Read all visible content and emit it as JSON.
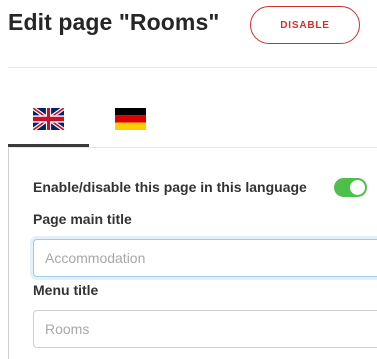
{
  "header": {
    "title": "Edit page \"Rooms\"",
    "disable_label": "DISABLE"
  },
  "tabs": [
    {
      "language": "English",
      "flag_icon": "uk-flag-icon",
      "active": true
    },
    {
      "language": "German",
      "flag_icon": "germany-flag-icon",
      "active": false
    }
  ],
  "form": {
    "enable_label": "Enable/disable this page in this language",
    "enable_toggle_on": true,
    "main_title_label": "Page main title",
    "main_title_placeholder": "Accommodation",
    "main_title_value": "",
    "menu_title_label": "Menu title",
    "menu_title_placeholder": "Rooms",
    "menu_title_value": ""
  },
  "colors": {
    "accent_red": "#d32f2f",
    "toggle_green": "#4cc04a",
    "focus_blue": "#9ecde6"
  }
}
